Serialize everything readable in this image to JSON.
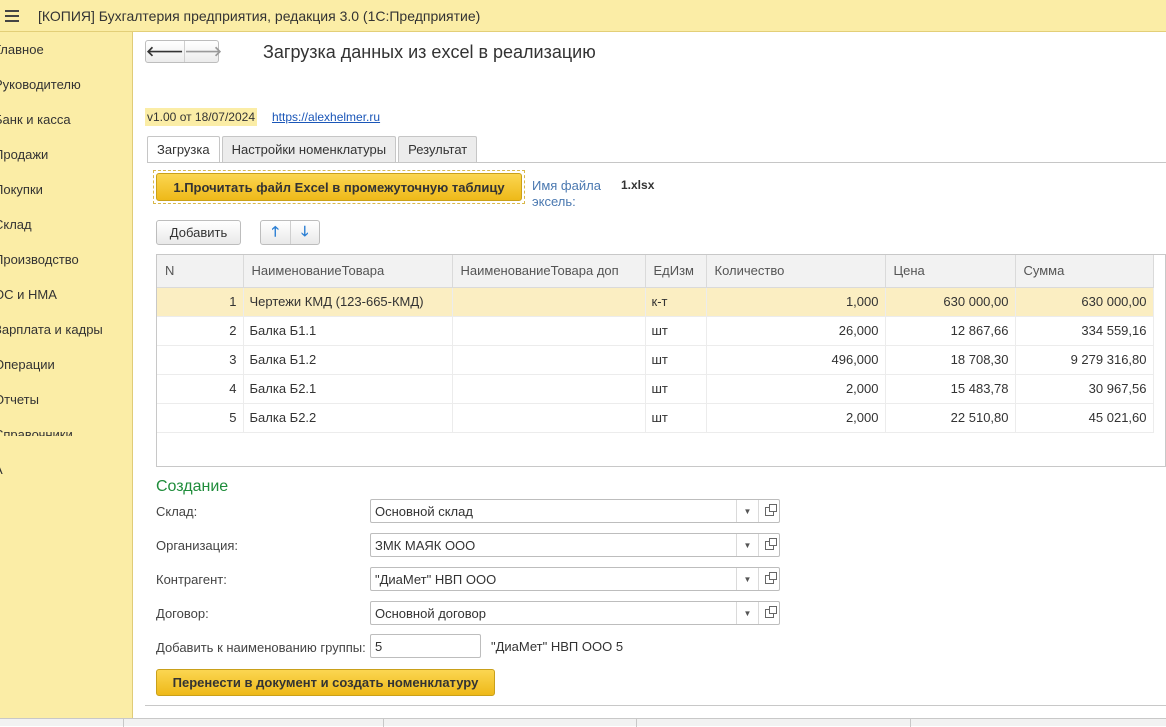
{
  "window": {
    "title": "[КОПИЯ] Бухгалтерия предприятия, редакция 3.0  (1С:Предприятие)"
  },
  "sidebar": {
    "items": [
      {
        "label": "Главное"
      },
      {
        "label": "Руководителю"
      },
      {
        "label": "Банк и касса"
      },
      {
        "label": "Продажи"
      },
      {
        "label": "Покупки"
      },
      {
        "label": "Склад"
      },
      {
        "label": "Производство"
      },
      {
        "label": "ОС и НМА"
      },
      {
        "label": "Зарплата и кадры"
      },
      {
        "label": "Операции"
      },
      {
        "label": "Отчеты"
      },
      {
        "label": "Справочники"
      },
      {
        "label": "А"
      }
    ]
  },
  "form": {
    "back_label": "🡐",
    "forward_label": "🡒",
    "title": "Загрузка данных из excel в реализацию",
    "version": "v1.00 от 18/07/2024",
    "link": "https://alexhelmer.ru"
  },
  "tabs": [
    {
      "label": "Загрузка",
      "active": true
    },
    {
      "label": "Настройки номенклатуры",
      "active": false
    },
    {
      "label": "Результат",
      "active": false
    }
  ],
  "load": {
    "read_button": "1.Прочитать файл Excel в промежуточную таблицу",
    "file_label": "Имя файла эксель:",
    "file_name": "1.xlsx",
    "add_button": "Добавить",
    "up_arrow": "🡑",
    "down_arrow": "🡓"
  },
  "table": {
    "columns": [
      "N",
      "НаименованиеТовара",
      "НаименованиеТовара доп",
      "ЕдИзм",
      "Количество",
      "Цена",
      "Сумма"
    ],
    "rows": [
      [
        "1",
        "Чертежи КМД (123-665-КМД)",
        "",
        "к-т",
        "1,000",
        "630 000,00",
        "630 000,00"
      ],
      [
        "2",
        "Балка Б1.1",
        "",
        "шт",
        "26,000",
        "12 867,66",
        "334 559,16"
      ],
      [
        "3",
        "Балка Б1.2",
        "",
        "шт",
        "496,000",
        "18 708,30",
        "9 279 316,80"
      ],
      [
        "4",
        "Балка Б2.1",
        "",
        "шт",
        "2,000",
        "15 483,78",
        "30 967,56"
      ],
      [
        "5",
        "Балка Б2.2",
        "",
        "шт",
        "2,000",
        "22 510,80",
        "45 021,60"
      ]
    ]
  },
  "creation": {
    "title": "Создание",
    "warehouse_label": "Склад:",
    "warehouse_value": "Основной склад",
    "org_label": "Организация:",
    "org_value": "ЗМК МАЯК ООО",
    "counterparty_label": "Контрагент:",
    "counterparty_value": "\"ДиаМет\" НВП ООО",
    "contract_label": "Договор:",
    "contract_value": "Основной договор",
    "group_label": "Добавить к наименованию группы:",
    "group_value": "5",
    "group_preview": "\"ДиаМет\" НВП ООО 5",
    "transfer_button": "Перенести в документ и создать номенклатуру"
  },
  "colors": {
    "accent_yellow": "#fbeda6",
    "button_yellow": "#eeb919",
    "section_green": "#1e8c3a",
    "link_blue": "#1a56b8",
    "selected_row": "#fbeec2"
  }
}
